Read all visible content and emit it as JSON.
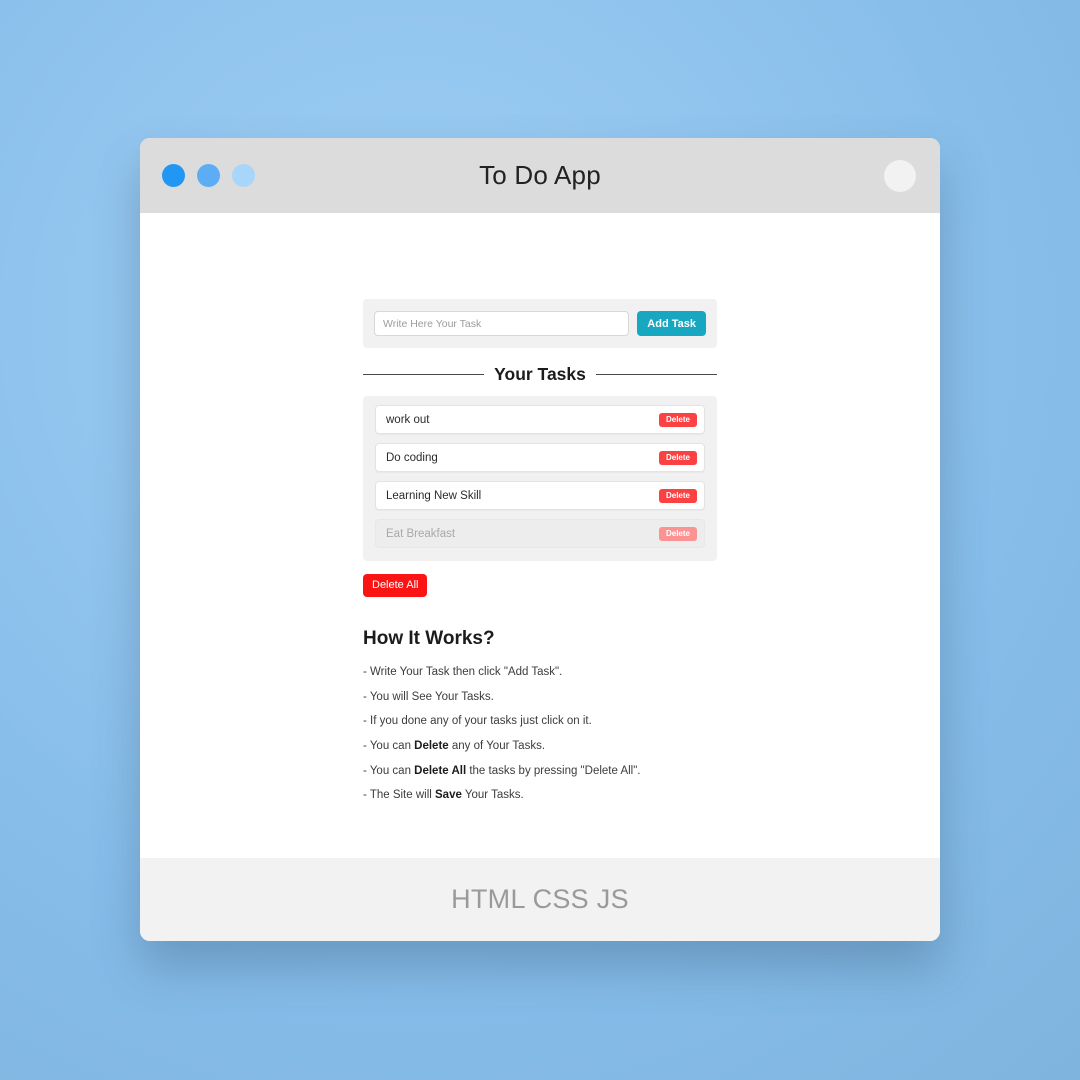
{
  "window": {
    "title": "To Do App",
    "dots": [
      {
        "name": "window-dot-blue-dark",
        "color": "#2196f3"
      },
      {
        "name": "window-dot-blue-mid",
        "color": "#5cadf6"
      },
      {
        "name": "window-dot-blue-light",
        "color": "#a8d6fb"
      }
    ],
    "corner_circle_color": "#f2f2f2",
    "titlebar_color": "#dcdcdc"
  },
  "add_form": {
    "input_value": "",
    "input_placeholder": "Write Here Your Task",
    "add_button_label": "Add Task",
    "add_button_color": "#17a7c0"
  },
  "tasks_section": {
    "legend": "Your Tasks",
    "delete_button_label": "Delete",
    "items": [
      {
        "label": "work out",
        "done": false
      },
      {
        "label": "Do coding",
        "done": false
      },
      {
        "label": "Learning New Skill",
        "done": false
      },
      {
        "label": "Eat Breakfast",
        "done": true
      }
    ],
    "delete_all_label": "Delete All",
    "delete_color": "#fb4141",
    "delete_all_color": "#fb1414"
  },
  "how_it_works": {
    "title": "How It Works?",
    "items": [
      {
        "pre": "- Write Your Task then click \"Add Task\".",
        "bold": "",
        "post": ""
      },
      {
        "pre": "- You will See Your Tasks.",
        "bold": "",
        "post": ""
      },
      {
        "pre": "- If you done any of your tasks just click on it.",
        "bold": "",
        "post": ""
      },
      {
        "pre": "- You can ",
        "bold": "Delete",
        "post": " any of Your Tasks."
      },
      {
        "pre": "- You can ",
        "bold": "Delete All",
        "post": " the tasks by pressing \"Delete All\"."
      },
      {
        "pre": "- The Site will ",
        "bold": "Save",
        "post": " Your Tasks."
      }
    ]
  },
  "footer": {
    "text": "HTML CSS JS"
  }
}
